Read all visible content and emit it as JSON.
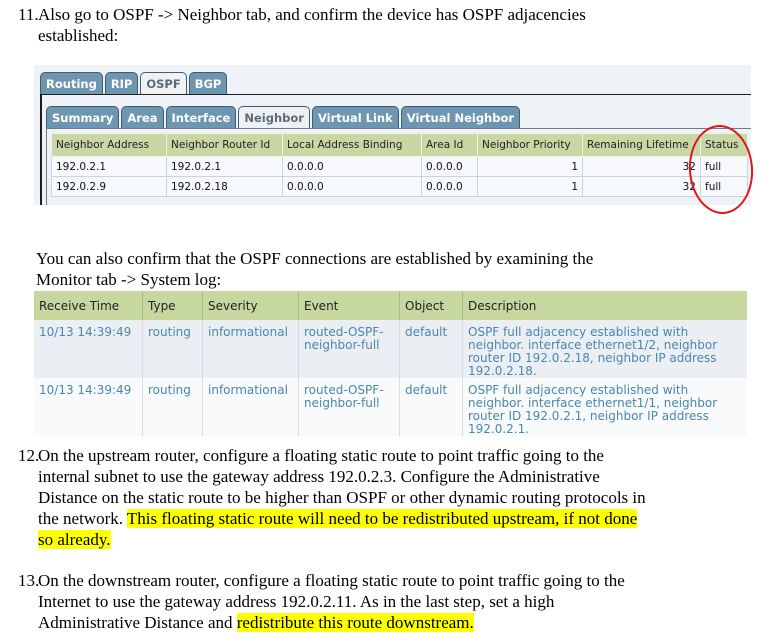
{
  "step11": {
    "number": "11.",
    "line1": "Also go to OSPF -> Neighbor tab, and confirm the device has OSPF adjacencies",
    "line2": "established:"
  },
  "ospf_panel": {
    "top_tabs": [
      {
        "label": "Routing",
        "active": false
      },
      {
        "label": "RIP",
        "active": false
      },
      {
        "label": "OSPF",
        "active": true
      },
      {
        "label": "BGP",
        "active": false
      }
    ],
    "sub_tabs": [
      {
        "label": "Summary",
        "active": false
      },
      {
        "label": "Area",
        "active": false
      },
      {
        "label": "Interface",
        "active": false
      },
      {
        "label": "Neighbor",
        "active": true
      },
      {
        "label": "Virtual Link",
        "active": false
      },
      {
        "label": "Virtual Neighbor",
        "active": false
      }
    ],
    "columns": [
      "Neighbor Address",
      "Neighbor Router Id",
      "Local Address Binding",
      "Area Id",
      "Neighbor Priority",
      "Remaining Lifetime",
      "Status"
    ],
    "rows": [
      [
        "192.0.2.1",
        "192.0.2.1",
        "0.0.0.0",
        "0.0.0.0",
        "1",
        "32",
        "full"
      ],
      [
        "192.0.2.9",
        "192.0.2.18",
        "0.0.0.0",
        "0.0.0.0",
        "1",
        "32",
        "full"
      ]
    ],
    "annotation_color": "#e0161a"
  },
  "monitor_text": {
    "line1": "You can also confirm that the OSPF connections are established by examining the",
    "line2": "Monitor tab -> System log:"
  },
  "system_log": {
    "columns": [
      "Receive Time",
      "Type",
      "Severity",
      "Event",
      "Object",
      "Description"
    ],
    "rows": [
      {
        "time": "10/13 14:39:49",
        "type": "routing",
        "severity": "informational",
        "event": "routed-OSPF-neighbor-full",
        "object": "default",
        "description": "OSPF full adjacency established with neighbor. interface ethernet1/2, neighbor router ID 192.0.2.18, neighbor IP address 192.0.2.18."
      },
      {
        "time": "10/13 14:39:49",
        "type": "routing",
        "severity": "informational",
        "event": "routed-OSPF-neighbor-full",
        "object": "default",
        "description": "OSPF full adjacency established with neighbor. interface ethernet1/1, neighbor router ID 192.0.2.1, neighbor IP address 192.0.2.1."
      }
    ]
  },
  "step12": {
    "number": "12.",
    "line1": "On the upstream router, configure a floating static route to point traffic going to the",
    "line2": "internal subnet to use the gateway address 192.0.2.3. Configure the Administrative",
    "line3": "Distance on the static route to be higher than OSPF or other dynamic routing protocols in",
    "line4_plain": "the network. ",
    "line4_highlight": "This floating static route will need to be redistributed upstream, if not done",
    "line5_highlight": "so already."
  },
  "step13": {
    "number": "13.",
    "line1": "On the downstream router, configure a floating static route to point traffic going to the",
    "line2": "Internet to use the gateway address 192.0.2.11. As in the last step, set a high",
    "line3_plain": "Administrative Distance and ",
    "line3_highlight": "redistribute this route downstream."
  },
  "highlight_color": "#ffff00"
}
